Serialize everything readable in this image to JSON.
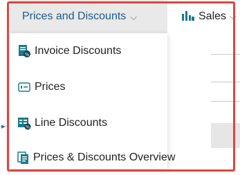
{
  "action_bar": {
    "menu_tab_label": "Prices and Discounts",
    "sales_label": "Sales"
  },
  "menu": {
    "items": [
      {
        "label": "Invoice Discounts",
        "icon": "invoice-discounts-icon"
      },
      {
        "label": "Prices",
        "icon": "prices-icon"
      },
      {
        "label": "Line Discounts",
        "icon": "line-discounts-icon"
      },
      {
        "label": "Prices & Discounts Overview",
        "icon": "prices-discounts-overview-icon"
      }
    ]
  },
  "colors": {
    "accent_text": "#1b5a8a",
    "highlight_border": "#e0453a",
    "tab_background": "#e9e9e9",
    "icon_teal": "#1a7a8c"
  }
}
